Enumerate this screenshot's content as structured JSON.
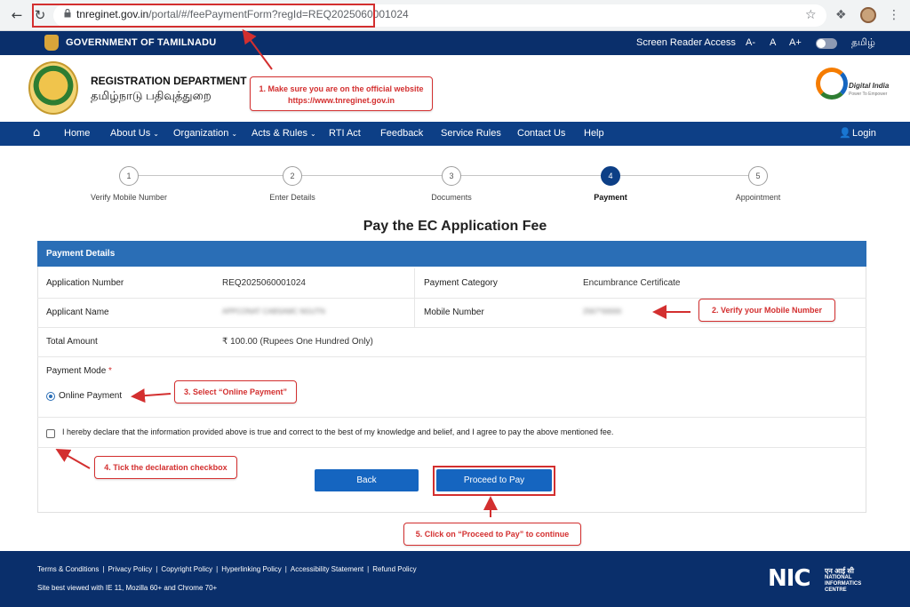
{
  "browser": {
    "url_host": "tnreginet.gov.in",
    "url_path": "/portal/#/feePaymentForm?regId=REQ2025060001024",
    "back_icon": "back-arrow-icon",
    "reload_icon": "reload-icon"
  },
  "govbar": {
    "title": "GOVERNMENT OF TAMILNADU",
    "screen_reader": "Screen Reader Access",
    "font_minus": "A-",
    "font_normal": "A",
    "font_plus": "A+",
    "language": "தமிழ்"
  },
  "header": {
    "dept_en": "REGISTRATION DEPARTMENT",
    "dept_ta": "தமிழ்நாடு பதிவுத்துறை",
    "digital_india": "Digital India",
    "digital_india_tagline": "Power To Empower"
  },
  "nav": {
    "items": [
      "Home",
      "About Us",
      "Organization",
      "Acts & Rules",
      "RTI Act",
      "Feedback",
      "Service Rules",
      "Contact Us",
      "Help"
    ],
    "login": "Login"
  },
  "steps": [
    {
      "num": "1",
      "label": "Verify Mobile Number"
    },
    {
      "num": "2",
      "label": "Enter Details"
    },
    {
      "num": "3",
      "label": "Documents"
    },
    {
      "num": "4",
      "label": "Payment"
    },
    {
      "num": "5",
      "label": "Appointment"
    }
  ],
  "page_title": "Pay the EC Application Fee",
  "payment": {
    "header": "Payment Details",
    "application_number_label": "Application Number",
    "application_number": "REQ2025060001024",
    "payment_category_label": "Payment Category",
    "payment_category": "Encumbrance Certificate",
    "applicant_name_label": "Applicant Name",
    "applicant_name": "APPCONAT CABSAMC NGUTN",
    "mobile_number_label": "Mobile Number",
    "mobile_number": "2567*00000",
    "total_amount_label": "Total Amount",
    "total_amount": "₹ 100.00 (Rupees One Hundred Only)",
    "payment_mode_label": "Payment Mode",
    "required_mark": "*",
    "online_payment": "Online Payment",
    "declaration": "I hereby declare that the information provided above is true and correct to the best of my knowledge and belief, and I agree to pay the above mentioned fee.",
    "back_button": "Back",
    "proceed_button": "Proceed to Pay"
  },
  "callouts": {
    "c1_line1": "1. Make sure you are on the official website",
    "c1_line2": "https://www.tnreginet.gov.in",
    "c2": "2. Verify your Mobile Number",
    "c3": "3. Select “Online Payment”",
    "c4": "4. Tick the declaration checkbox",
    "c5": "5. Click on “Proceed to Pay” to continue"
  },
  "footer": {
    "links": [
      "Terms & Conditions",
      "Privacy Policy",
      "Copyright Policy",
      "Hyperlinking Policy",
      "Accessibility Statement",
      "Refund Policy"
    ],
    "browsers": "Site best viewed with IE 11, Mozilla 60+ and Chrome 70+",
    "nic": "NIC",
    "nic_hindi": "एन आई सी",
    "nic_line1": "NATIONAL",
    "nic_line2": "INFORMATICS",
    "nic_line3": "CENTRE"
  },
  "colors": {
    "navy": "#0a2f6b",
    "nav_blue": "#0d3f86",
    "card_header": "#2a6eb6",
    "button": "#1565c0",
    "callout_red": "#d32f2f"
  }
}
